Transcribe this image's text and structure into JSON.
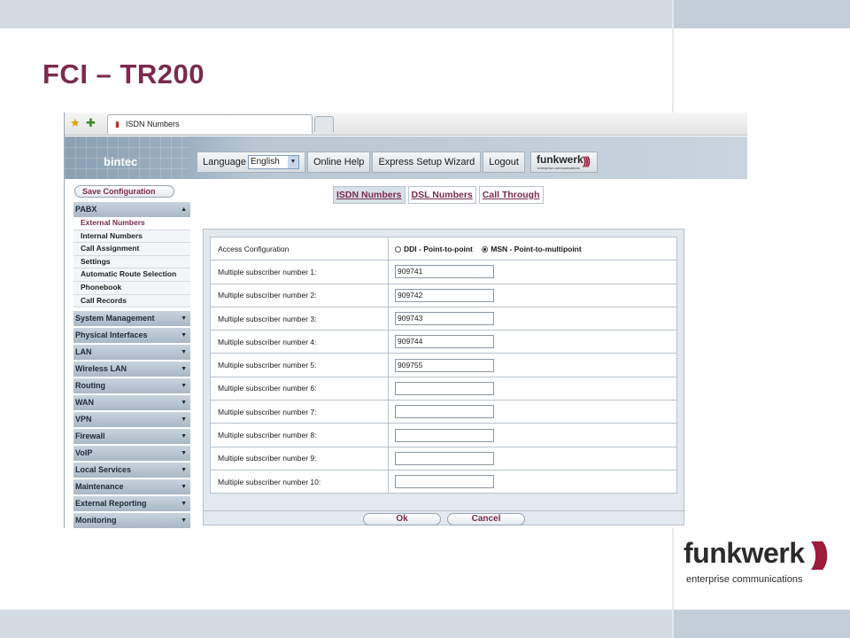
{
  "slide": {
    "title": "FCI – TR200"
  },
  "browser": {
    "favorites_icon": "star-icon",
    "add_favorite_icon": "add-favorite-icon",
    "tab_label": "ISDN Numbers"
  },
  "header": {
    "brand": "bintec",
    "language_label": "Language",
    "language_value": "English",
    "online_help": "Online Help",
    "express_setup": "Express Setup Wizard",
    "logout": "Logout",
    "logo_word": "funkwerk",
    "logo_sub": "enterprise communications"
  },
  "sidebar": {
    "save_configuration": "Save Configuration",
    "pabx": {
      "label": "PABX",
      "items": [
        "External Numbers",
        "Internal Numbers",
        "Call Assignment",
        "Settings",
        "Automatic Route Selection",
        "Phonebook",
        "Call Records"
      ]
    },
    "sections": [
      "System Management",
      "Physical Interfaces",
      "LAN",
      "Wireless LAN",
      "Routing",
      "WAN",
      "VPN",
      "Firewall",
      "VoIP",
      "Local Services",
      "Maintenance",
      "External Reporting",
      "Monitoring"
    ]
  },
  "tabs": [
    "ISDN Numbers",
    "DSL Numbers",
    "Call Through"
  ],
  "form": {
    "access_label": "Access Configuration",
    "option_ddi": "DDI - Point-to-point",
    "option_msn": "MSN - Point-to-multipoint",
    "selected_option": "MSN - Point-to-multipoint",
    "msn_labels": [
      "Multiple subscriber number 1:",
      "Multiple subscriber number 2:",
      "Multiple subscriber number 3:",
      "Multiple subscriber number 4:",
      "Multiple subscriber number 5:",
      "Multiple subscriber number 6:",
      "Multiple subscriber number 7:",
      "Multiple subscriber number 8:",
      "Multiple subscriber number 9:",
      "Multiple subscriber number 10:"
    ],
    "msn_values": [
      "909741",
      "909742",
      "909743",
      "909744",
      "909755",
      "",
      "",
      "",
      "",
      ""
    ],
    "ok": "Ok",
    "cancel": "Cancel"
  },
  "corner_logo": {
    "word": "funkwerk",
    "tagline": "enterprise communications"
  },
  "colors": {
    "title": "#7a2a4e",
    "logo_waves": "#9c1c3a",
    "band": "#d3dbe3"
  }
}
